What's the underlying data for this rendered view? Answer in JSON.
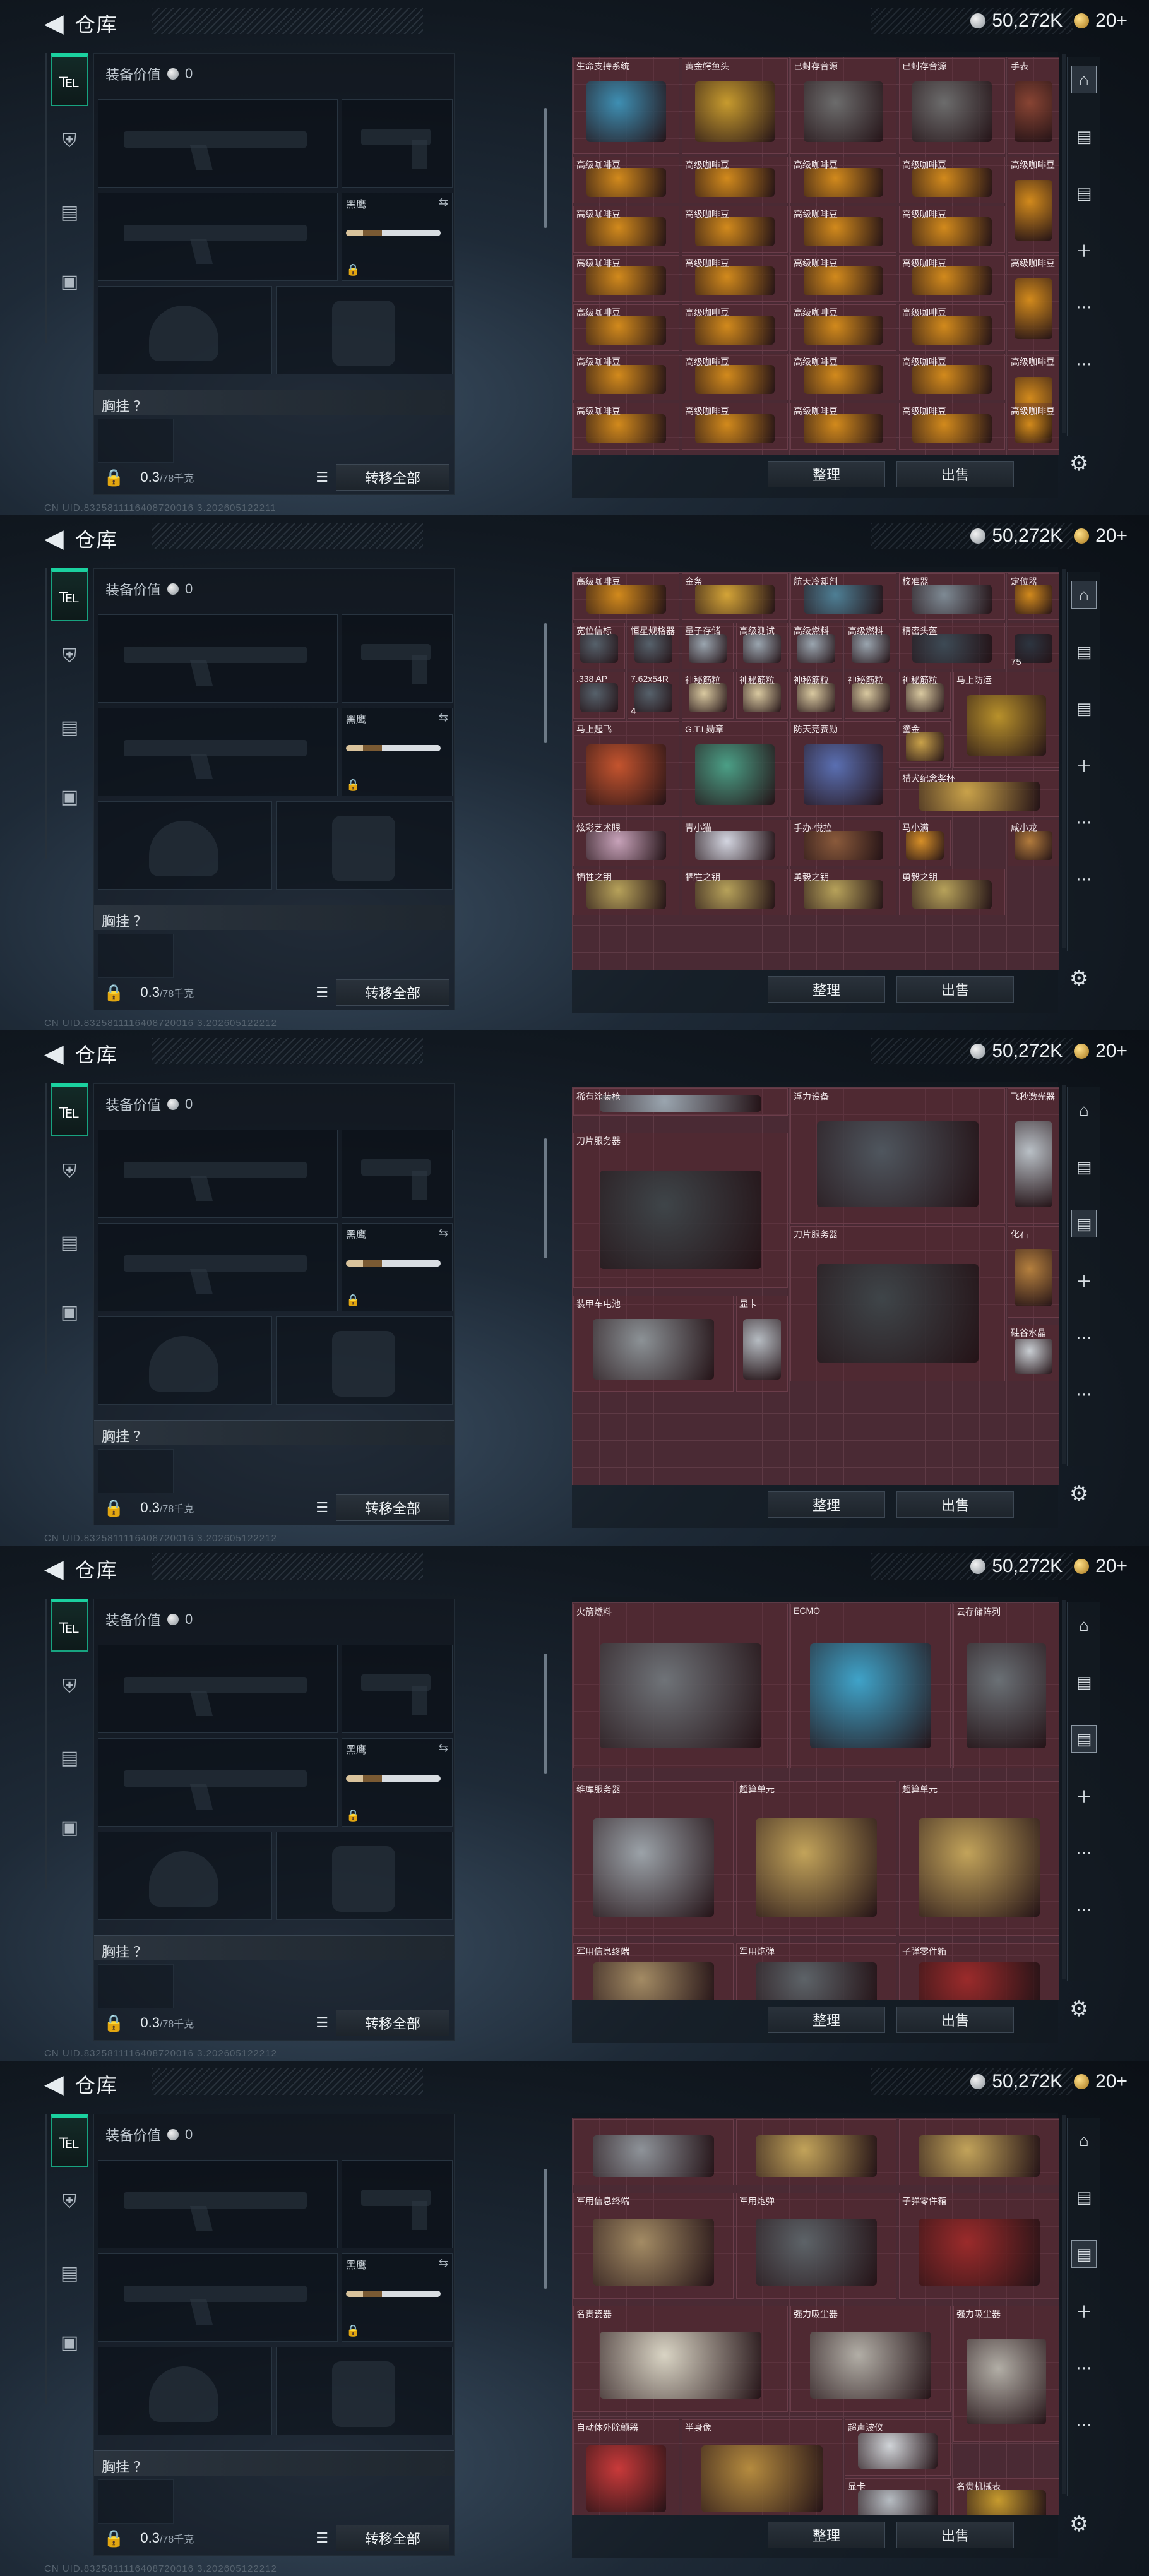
{
  "header": {
    "back_icon": "chevron-left-icon",
    "title": "仓库",
    "coins": "50,272K",
    "gold": "20+"
  },
  "loadout": {
    "value_label": "装备价值",
    "value": "0",
    "melee_name": "黑鹰",
    "chest_label": "胸挂 ？",
    "weight": "0.3",
    "weight_max": "/78千克",
    "transfer_all": "转移全部"
  },
  "uids": [
    "CN UID.8325811116408720016 3.202605122211",
    "CN UID.8325811116408720016 3.202605122212",
    "CN UID.8325811116408720016 3.202605122212",
    "CN UID.8325811116408720016 3.202605122212",
    "CN UID.8325811116408720016 3.202605122212"
  ],
  "warehouse": {
    "sort": "整理",
    "sell": "出售"
  },
  "rail_icons": [
    "vault-icon",
    "tag-icon",
    "tag-icon",
    "plus-icon"
  ],
  "colors": {
    "accent": "#1bd19f",
    "grid_bg": "#4a2a34",
    "grid_line": "#5e3a45"
  },
  "screens": [
    {
      "items": [
        {
          "name": "生命支持系统",
          "col": 0,
          "row": 0,
          "w": 1,
          "h": 1,
          "c": "#3e8fb3"
        },
        {
          "name": "黄金鳄鱼头",
          "col": 1,
          "row": 0,
          "w": 1,
          "h": 1,
          "c": "#c79b2e"
        },
        {
          "name": "已封存音源",
          "col": 2,
          "row": 0,
          "w": 1,
          "h": 1,
          "c": "#6c6c6c"
        },
        {
          "name": "已封存音源",
          "col": 3,
          "row": 0,
          "w": 1,
          "h": 1,
          "c": "#6c6c6c"
        },
        {
          "name": "手表",
          "col": 4,
          "row": 0,
          "w": 0.5,
          "h": 1,
          "c": "#884433"
        },
        {
          "name": "高级咖啡豆",
          "col": 0,
          "row": 1,
          "w": 1,
          "h": 0.5,
          "c": "#d28a1c"
        },
        {
          "name": "高级咖啡豆",
          "col": 1,
          "row": 1,
          "w": 1,
          "h": 0.5,
          "c": "#d28a1c"
        },
        {
          "name": "高级咖啡豆",
          "col": 2,
          "row": 1,
          "w": 1,
          "h": 0.5,
          "c": "#d28a1c"
        },
        {
          "name": "高级咖啡豆",
          "col": 3,
          "row": 1,
          "w": 1,
          "h": 0.5,
          "c": "#d28a1c"
        },
        {
          "name": "高级咖啡豆",
          "col": 0,
          "row": 1.5,
          "w": 1,
          "h": 0.5,
          "c": "#d28a1c"
        },
        {
          "name": "高级咖啡豆",
          "col": 1,
          "row": 1.5,
          "w": 1,
          "h": 0.5,
          "c": "#d28a1c"
        },
        {
          "name": "高级咖啡豆",
          "col": 2,
          "row": 1.5,
          "w": 1,
          "h": 0.5,
          "c": "#d28a1c"
        },
        {
          "name": "高级咖啡豆",
          "col": 3,
          "row": 1.5,
          "w": 1,
          "h": 0.5,
          "c": "#d28a1c"
        },
        {
          "name": "高级咖啡豆",
          "col": 0,
          "row": 2,
          "w": 1,
          "h": 0.5,
          "c": "#d28a1c"
        },
        {
          "name": "高级咖啡豆",
          "col": 1,
          "row": 2,
          "w": 1,
          "h": 0.5,
          "c": "#d28a1c"
        },
        {
          "name": "高级咖啡豆",
          "col": 2,
          "row": 2,
          "w": 1,
          "h": 0.5,
          "c": "#d28a1c"
        },
        {
          "name": "高级咖啡豆",
          "col": 3,
          "row": 2,
          "w": 1,
          "h": 0.5,
          "c": "#d28a1c"
        },
        {
          "name": "高级咖啡豆",
          "col": 0,
          "row": 2.5,
          "w": 1,
          "h": 0.5,
          "c": "#d28a1c"
        },
        {
          "name": "高级咖啡豆",
          "col": 1,
          "row": 2.5,
          "w": 1,
          "h": 0.5,
          "c": "#d28a1c"
        },
        {
          "name": "高级咖啡豆",
          "col": 2,
          "row": 2.5,
          "w": 1,
          "h": 0.5,
          "c": "#d28a1c"
        },
        {
          "name": "高级咖啡豆",
          "col": 3,
          "row": 2.5,
          "w": 1,
          "h": 0.5,
          "c": "#d28a1c"
        },
        {
          "name": "高级咖啡豆",
          "col": 0,
          "row": 3,
          "w": 1,
          "h": 0.5,
          "c": "#d28a1c"
        },
        {
          "name": "高级咖啡豆",
          "col": 1,
          "row": 3,
          "w": 1,
          "h": 0.5,
          "c": "#d28a1c"
        },
        {
          "name": "高级咖啡豆",
          "col": 2,
          "row": 3,
          "w": 1,
          "h": 0.5,
          "c": "#d28a1c"
        },
        {
          "name": "高级咖啡豆",
          "col": 3,
          "row": 3,
          "w": 1,
          "h": 0.5,
          "c": "#d28a1c"
        },
        {
          "name": "高级咖啡豆",
          "col": 4,
          "row": 1,
          "w": 0.5,
          "h": 1,
          "c": "#d28a1c"
        },
        {
          "name": "高级咖啡豆",
          "col": 4,
          "row": 2,
          "w": 0.5,
          "h": 1,
          "c": "#d28a1c"
        },
        {
          "name": "高级咖啡豆",
          "col": 4,
          "row": 3,
          "w": 0.5,
          "h": 1,
          "c": "#d28a1c"
        },
        {
          "name": "高级咖啡豆",
          "col": 0,
          "row": 3.5,
          "w": 1,
          "h": 0.5,
          "c": "#d28a1c"
        },
        {
          "name": "高级咖啡豆",
          "col": 1,
          "row": 3.5,
          "w": 1,
          "h": 0.5,
          "c": "#d28a1c"
        },
        {
          "name": "高级咖啡豆",
          "col": 2,
          "row": 3.5,
          "w": 1,
          "h": 0.5,
          "c": "#d28a1c"
        },
        {
          "name": "高级咖啡豆",
          "col": 3,
          "row": 3.5,
          "w": 1,
          "h": 0.5,
          "c": "#d28a1c"
        },
        {
          "name": "高级咖啡豆",
          "col": 4,
          "row": 3.5,
          "w": 0.5,
          "h": 0.5,
          "c": "#d28a1c"
        }
      ]
    },
    {
      "items": [
        {
          "name": "高级咖啡豆",
          "col": 0,
          "row": 0,
          "w": 1,
          "h": 0.5,
          "c": "#d28a1c"
        },
        {
          "name": "金条",
          "col": 1,
          "row": 0,
          "w": 1,
          "h": 0.5,
          "c": "#d4a437"
        },
        {
          "name": "航天冷却剂",
          "col": 2,
          "row": 0,
          "w": 1,
          "h": 0.5,
          "c": "#4e7f95"
        },
        {
          "name": "校准器",
          "col": 3,
          "row": 0,
          "w": 1,
          "h": 0.5,
          "c": "#7e8a94"
        },
        {
          "name": "定位器",
          "col": 4,
          "row": 0,
          "w": 0.5,
          "h": 0.5,
          "c": "#d28a1c"
        },
        {
          "name": "宽位信标",
          "col": 0,
          "row": 0.5,
          "w": 0.5,
          "h": 0.5,
          "c": "#56616b"
        },
        {
          "name": "恒星规格器",
          "col": 0.5,
          "row": 0.5,
          "w": 0.5,
          "h": 0.5,
          "c": "#56616b"
        },
        {
          "name": "量子存储",
          "col": 1,
          "row": 0.5,
          "w": 0.5,
          "h": 0.5,
          "c": "#9aa5af"
        },
        {
          "name": "高级测试",
          "col": 1.5,
          "row": 0.5,
          "w": 0.5,
          "h": 0.5,
          "c": "#9aa5af"
        },
        {
          "name": "高级燃料",
          "col": 2,
          "row": 0.5,
          "w": 0.5,
          "h": 0.5,
          "c": "#9aa5af"
        },
        {
          "name": "高级燃料",
          "col": 2.5,
          "row": 0.5,
          "w": 0.5,
          "h": 0.5,
          "c": "#9aa5af"
        },
        {
          "name": "精密头盔",
          "col": 3,
          "row": 0.5,
          "w": 1,
          "h": 0.5,
          "c": "#3d4a55"
        },
        {
          "name": "",
          "col": 4,
          "row": 0.5,
          "w": 0.5,
          "h": 0.5,
          "c": "#2d3540",
          "sub": "75"
        },
        {
          "name": ".338 AP",
          "col": 0,
          "row": 1,
          "w": 0.5,
          "h": 0.5,
          "c": "#56616b"
        },
        {
          "name": "7.62x54R",
          "col": 0.5,
          "row": 1,
          "w": 0.5,
          "h": 0.5,
          "c": "#56616b",
          "sub": "4"
        },
        {
          "name": "神秘筋粒",
          "col": 1,
          "row": 1,
          "w": 0.5,
          "h": 0.5,
          "c": "#d9c9a0"
        },
        {
          "name": "神秘筋粒",
          "col": 1.5,
          "row": 1,
          "w": 0.5,
          "h": 0.5,
          "c": "#d9c9a0"
        },
        {
          "name": "神秘筋粒",
          "col": 2,
          "row": 1,
          "w": 0.5,
          "h": 0.5,
          "c": "#d9c9a0"
        },
        {
          "name": "神秘筋粒",
          "col": 2.5,
          "row": 1,
          "w": 0.5,
          "h": 0.5,
          "c": "#d9c9a0"
        },
        {
          "name": "神秘筋粒",
          "col": 3,
          "row": 1,
          "w": 0.5,
          "h": 0.5,
          "c": "#d9c9a0"
        },
        {
          "name": "马上防运",
          "col": 3.5,
          "row": 1,
          "w": 1,
          "h": 1,
          "c": "#b8912b"
        },
        {
          "name": "马上起飞",
          "col": 0,
          "row": 1.5,
          "w": 1,
          "h": 1,
          "c": "#c4542e"
        },
        {
          "name": "G.T.I.勋章",
          "col": 1,
          "row": 1.5,
          "w": 1,
          "h": 1,
          "c": "#4b9f86"
        },
        {
          "name": "防天竞赛勋",
          "col": 2,
          "row": 1.5,
          "w": 1,
          "h": 1,
          "c": "#5a6fb2"
        },
        {
          "name": "鎏金",
          "col": 3,
          "row": 1.5,
          "w": 0.5,
          "h": 0.5,
          "c": "#c9a24a"
        },
        {
          "name": "猎犬纪念奖杯",
          "col": 3,
          "row": 2,
          "w": 1.5,
          "h": 0.5,
          "c": "#c9a24a"
        },
        {
          "name": "炫彩艺术眼",
          "col": 0,
          "row": 2.5,
          "w": 1,
          "h": 0.5,
          "c": "#c7a2b9"
        },
        {
          "name": "青小猫",
          "col": 1,
          "row": 2.5,
          "w": 1,
          "h": 0.5,
          "c": "#d3d5e0"
        },
        {
          "name": "手办·悦拉",
          "col": 2,
          "row": 2.5,
          "w": 1,
          "h": 0.5,
          "c": "#8a5a3b"
        },
        {
          "name": "马小满",
          "col": 3,
          "row": 2.5,
          "w": 0.5,
          "h": 0.5,
          "c": "#d68f28"
        },
        {
          "name": "咸小龙",
          "col": 4,
          "row": 2.5,
          "w": 0.5,
          "h": 0.5,
          "c": "#b27b3c"
        },
        {
          "name": "牺牲之钥",
          "col": 0,
          "row": 3,
          "w": 1,
          "h": 0.5,
          "c": "#b7a25a"
        },
        {
          "name": "牺牲之钥",
          "col": 1,
          "row": 3,
          "w": 1,
          "h": 0.5,
          "c": "#b7a25a"
        },
        {
          "name": "勇毅之钥",
          "col": 2,
          "row": 3,
          "w": 1,
          "h": 0.5,
          "c": "#b7a25a"
        },
        {
          "name": "勇毅之钥",
          "col": 3,
          "row": 3,
          "w": 1,
          "h": 0.5,
          "c": "#b7a25a"
        }
      ]
    },
    {
      "items": [
        {
          "name": "稀有涂装枪",
          "col": 0,
          "row": 0,
          "w": 2,
          "h": 0.3,
          "c": "#9aa5af"
        },
        {
          "name": "浮力设备",
          "col": 2,
          "row": 0,
          "w": 2,
          "h": 1.4,
          "c": "#4f565e"
        },
        {
          "name": "飞秒激光器",
          "col": 4,
          "row": 0,
          "w": 0.5,
          "h": 1.4,
          "c": "#b9c0c6"
        },
        {
          "name": "刀片服务器",
          "col": 0,
          "row": 0.45,
          "w": 2,
          "h": 1.6,
          "c": "#3f4549"
        },
        {
          "name": "刀片服务器",
          "col": 2,
          "row": 1.4,
          "w": 2,
          "h": 1.6,
          "c": "#3f4549"
        },
        {
          "name": "化石",
          "col": 4,
          "row": 1.4,
          "w": 0.5,
          "h": 0.95,
          "c": "#b5803e"
        },
        {
          "name": "装甲车电池",
          "col": 0,
          "row": 2.1,
          "w": 1.5,
          "h": 1,
          "c": "#8c9296"
        },
        {
          "name": "显卡",
          "col": 1.5,
          "row": 2.1,
          "w": 0.5,
          "h": 1,
          "c": "#b6bcc2"
        },
        {
          "name": "硅谷水晶",
          "col": 4,
          "row": 2.4,
          "w": 0.5,
          "h": 0.6,
          "c": "#c9ced3"
        }
      ]
    },
    {
      "items": [
        {
          "name": "火箭燃料",
          "col": 0,
          "row": 0,
          "w": 2,
          "h": 1.7,
          "c": "#6f7378"
        },
        {
          "name": "ECMO",
          "col": 2,
          "row": 0,
          "w": 1.5,
          "h": 1.7,
          "c": "#3fa3c9"
        },
        {
          "name": "云存储阵列",
          "col": 3.5,
          "row": 0,
          "w": 1,
          "h": 1.7,
          "c": "#6a7075"
        },
        {
          "name": "维库服务器",
          "col": 0,
          "row": 1.8,
          "w": 1.5,
          "h": 1.6,
          "c": "#9ba2a8"
        },
        {
          "name": "超算单元",
          "col": 1.5,
          "row": 1.8,
          "w": 1.5,
          "h": 1.6,
          "c": "#c2a35a"
        },
        {
          "name": "超算单元",
          "col": 3,
          "row": 1.8,
          "w": 1.5,
          "h": 1.6,
          "c": "#c2a35a"
        },
        {
          "name": "军用信息终端",
          "col": 0,
          "row": 3.45,
          "w": 1.5,
          "h": 0.8,
          "c": "#a38b64"
        },
        {
          "name": "军用炮弹",
          "col": 1.5,
          "row": 3.45,
          "w": 1.5,
          "h": 0.8,
          "c": "#5d6368"
        },
        {
          "name": "子弹零件箱",
          "col": 3,
          "row": 3.45,
          "w": 1.5,
          "h": 0.8,
          "c": "#9b2b2b"
        }
      ]
    },
    {
      "items": [
        {
          "name": "",
          "col": 0,
          "row": 0,
          "w": 1.5,
          "h": 0.7,
          "c": "#8e9399"
        },
        {
          "name": "",
          "col": 1.5,
          "row": 0,
          "w": 1.5,
          "h": 0.7,
          "c": "#c2a35a"
        },
        {
          "name": "",
          "col": 3,
          "row": 0,
          "w": 1.5,
          "h": 0.7,
          "c": "#c2a35a"
        },
        {
          "name": "军用信息终端",
          "col": 0,
          "row": 0.75,
          "w": 1.5,
          "h": 1.1,
          "c": "#a38b64"
        },
        {
          "name": "军用炮弹",
          "col": 1.5,
          "row": 0.75,
          "w": 1.5,
          "h": 1.1,
          "c": "#5d6368"
        },
        {
          "name": "子弹零件箱",
          "col": 3,
          "row": 0.75,
          "w": 1.5,
          "h": 1.1,
          "c": "#9b2b2b"
        },
        {
          "name": "名贵瓷器",
          "col": 0,
          "row": 1.9,
          "w": 2,
          "h": 1.1,
          "c": "#d9d4c4"
        },
        {
          "name": "强力吸尘器",
          "col": 2,
          "row": 1.9,
          "w": 1.5,
          "h": 1.1,
          "c": "#b2aea6"
        },
        {
          "name": "强力吸尘器",
          "col": 3.5,
          "row": 1.9,
          "w": 1,
          "h": 1.4,
          "c": "#b2aea6"
        },
        {
          "name": "自动体外除颤器",
          "col": 0,
          "row": 3.05,
          "w": 1,
          "h": 1.1,
          "c": "#c93a3a"
        },
        {
          "name": "半身像",
          "col": 1,
          "row": 3.05,
          "w": 1.5,
          "h": 1.1,
          "c": "#b58b3f"
        },
        {
          "name": "超声波仪",
          "col": 2.5,
          "row": 3.05,
          "w": 1,
          "h": 0.6,
          "c": "#d0d4d8"
        },
        {
          "name": "显卡",
          "col": 2.5,
          "row": 3.65,
          "w": 1,
          "h": 0.5,
          "c": "#b6bcc2"
        },
        {
          "name": "名贵机械表",
          "col": 3.5,
          "row": 3.65,
          "w": 1,
          "h": 0.5,
          "c": "#c79b2e"
        }
      ]
    }
  ]
}
